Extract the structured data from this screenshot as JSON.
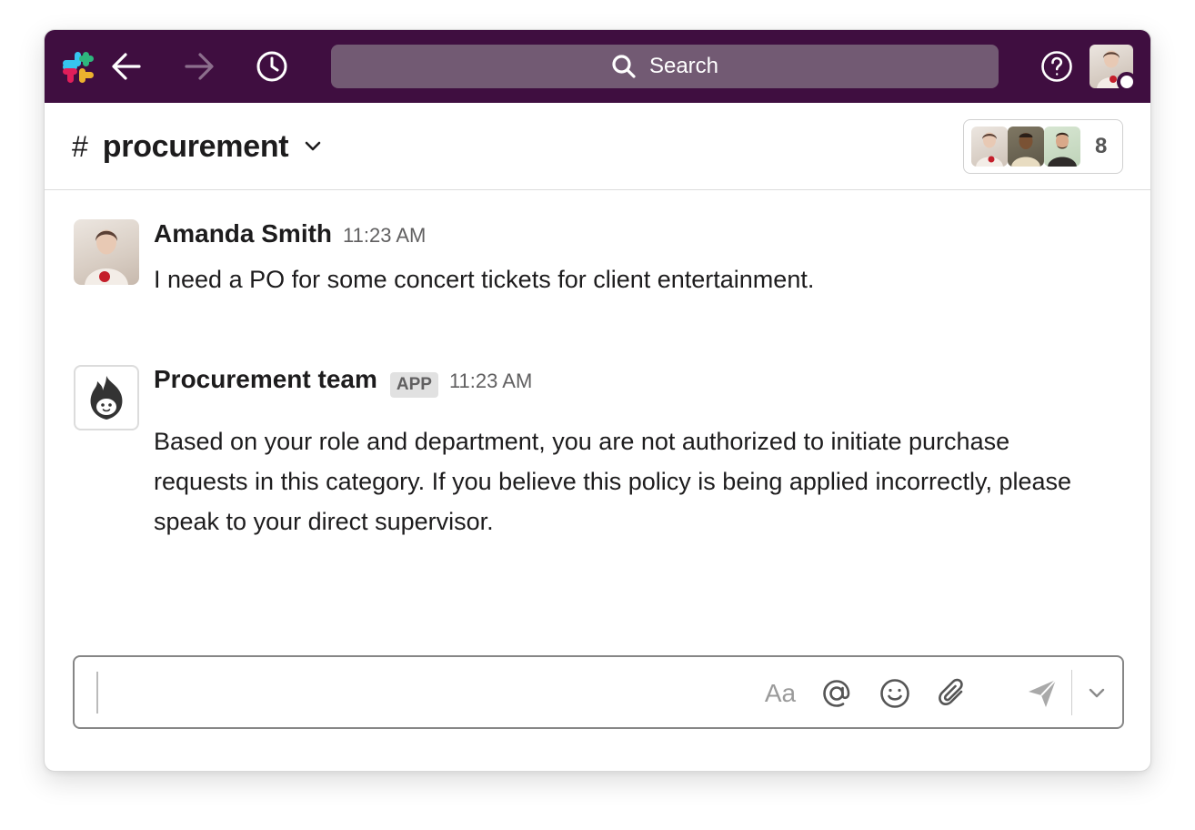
{
  "topbar": {
    "search_placeholder": "Search",
    "icons": [
      "slack-logo-icon",
      "back-arrow-icon",
      "forward-arrow-icon",
      "history-icon",
      "search-icon",
      "help-icon"
    ]
  },
  "channel": {
    "hash": "#",
    "name": "procurement",
    "member_count": "8"
  },
  "messages": [
    {
      "author": "Amanda Smith",
      "time": "11:23 AM",
      "text": "I need a PO for some concert tickets for client entertainment."
    },
    {
      "author": "Procurement team",
      "badge": "APP",
      "time": "11:23 AM",
      "text": "Based on your role and department, you are not authorized to initiate purchase requests in this category. If you believe this policy is being applied incorrectly, please speak to your direct supervisor."
    }
  ],
  "composer": {
    "value": "",
    "format_label": "Aa"
  },
  "colors": {
    "topbar": "#3f0e40",
    "search_bg": "#725a73",
    "text": "#1d1c1d",
    "muted": "#616061"
  }
}
